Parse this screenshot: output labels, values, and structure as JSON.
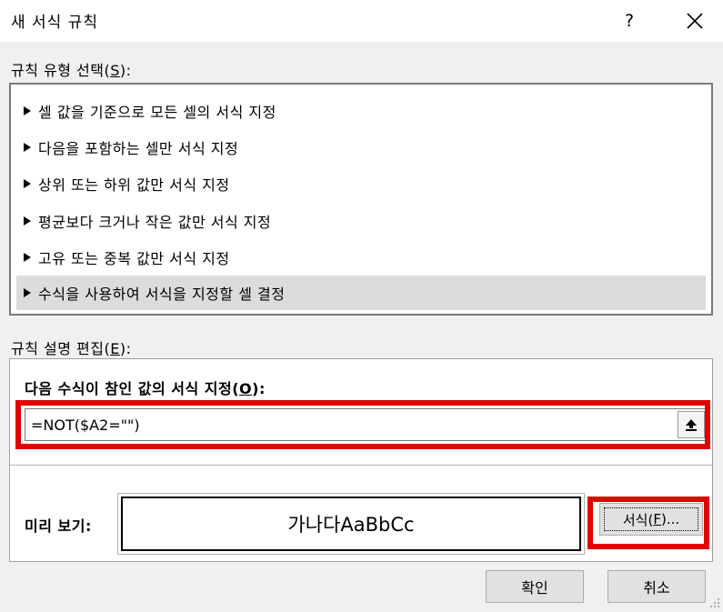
{
  "window": {
    "title": "새 서식 규칙",
    "help_label": "?"
  },
  "rule_type": {
    "label_main": "규칙 유형 선택(",
    "label_key": "S",
    "label_tail": "):",
    "items": [
      {
        "label": "셀 값을 기준으로 모든 셀의 서식 지정"
      },
      {
        "label": "다음을 포함하는 셀만 서식 지정"
      },
      {
        "label": "상위 또는 하위 값만 서식 지정"
      },
      {
        "label": "평균보다 크거나 작은 값만 서식 지정"
      },
      {
        "label": "고유 또는 중복 값만 서식 지정"
      },
      {
        "label": "수식을 사용하여 서식을 지정할 셀 결정"
      }
    ],
    "selected_index": 5
  },
  "rule_edit": {
    "label_main": "규칙 설명 편집(",
    "label_key": "E",
    "label_tail": "):",
    "formula_label_main": "다음 수식이 참인 값의 서식 지정(",
    "formula_label_key": "O",
    "formula_label_tail": "):",
    "formula_value": "=NOT($A2=\"\")",
    "collapse_icon": "collapse-up-arrow-icon"
  },
  "preview": {
    "label": "미리 보기:",
    "sample_text": "가나다AaBbCc",
    "format_button_main": "서식(",
    "format_button_key": "F",
    "format_button_tail": ")..."
  },
  "buttons": {
    "ok": "확인",
    "cancel": "취소"
  },
  "colors": {
    "highlight_frame": "#e00000",
    "selected_row": "#dcdcdc",
    "dialog_bg": "#f0f0f0"
  }
}
